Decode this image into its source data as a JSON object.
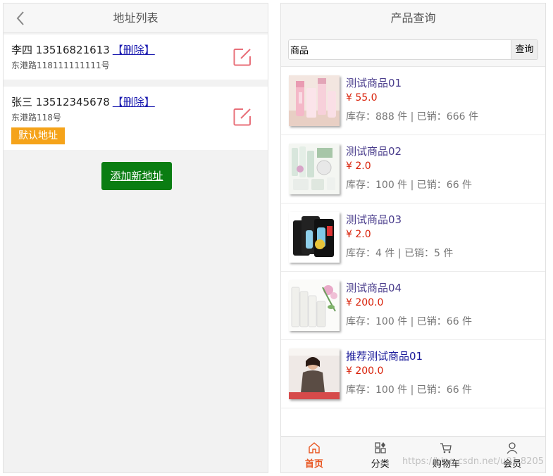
{
  "address_page": {
    "title": "地址列表",
    "addresses": [
      {
        "name": "李四",
        "phone": "13516821613",
        "delete_label": "【删除】",
        "street": "东港路118111111111号",
        "is_default": false
      },
      {
        "name": "张三",
        "phone": "13512345678",
        "delete_label": "【删除】",
        "street": "东港路118号",
        "is_default": true
      }
    ],
    "default_badge": "默认地址",
    "add_button": "添加新地址",
    "icons": {
      "back": "chevron-left-icon",
      "edit": "edit-icon"
    },
    "colors": {
      "edit_icon": "#e8707a",
      "badge": "#f5a31a",
      "add_button": "#0a7d12",
      "delete_link": "#1c1cb0"
    }
  },
  "product_page": {
    "title": "产品查询",
    "search": {
      "value": "商品",
      "button": "查询"
    },
    "products": [
      {
        "name": "测试商品01",
        "price": "¥ 55.0",
        "stock": "库存：888 件 | 已销：666 件"
      },
      {
        "name": "测试商品02",
        "price": "¥ 2.0",
        "stock": "库存：100 件 | 已销：66 件"
      },
      {
        "name": "测试商品03",
        "price": "¥ 2.0",
        "stock": "库存：4 件 | 已销：5 件"
      },
      {
        "name": "测试商品04",
        "price": "¥ 200.0",
        "stock": "库存：100 件 | 已销：66 件"
      },
      {
        "name": "推荐测试商品01",
        "price": "¥ 200.0",
        "stock": "库存：100 件 | 已销：66 件"
      }
    ],
    "tabs": [
      {
        "label": "首页",
        "icon": "home-icon",
        "active": true
      },
      {
        "label": "分类",
        "icon": "grid-icon",
        "active": false
      },
      {
        "label": "购物车",
        "icon": "cart-icon",
        "active": false
      },
      {
        "label": "会员",
        "icon": "user-icon",
        "active": false
      }
    ],
    "watermark": "https://blog.csdn.net/u01    8205",
    "colors": {
      "price": "#d81e06",
      "active_tab": "#e8541e",
      "product_name": "#4a3d8c"
    }
  }
}
